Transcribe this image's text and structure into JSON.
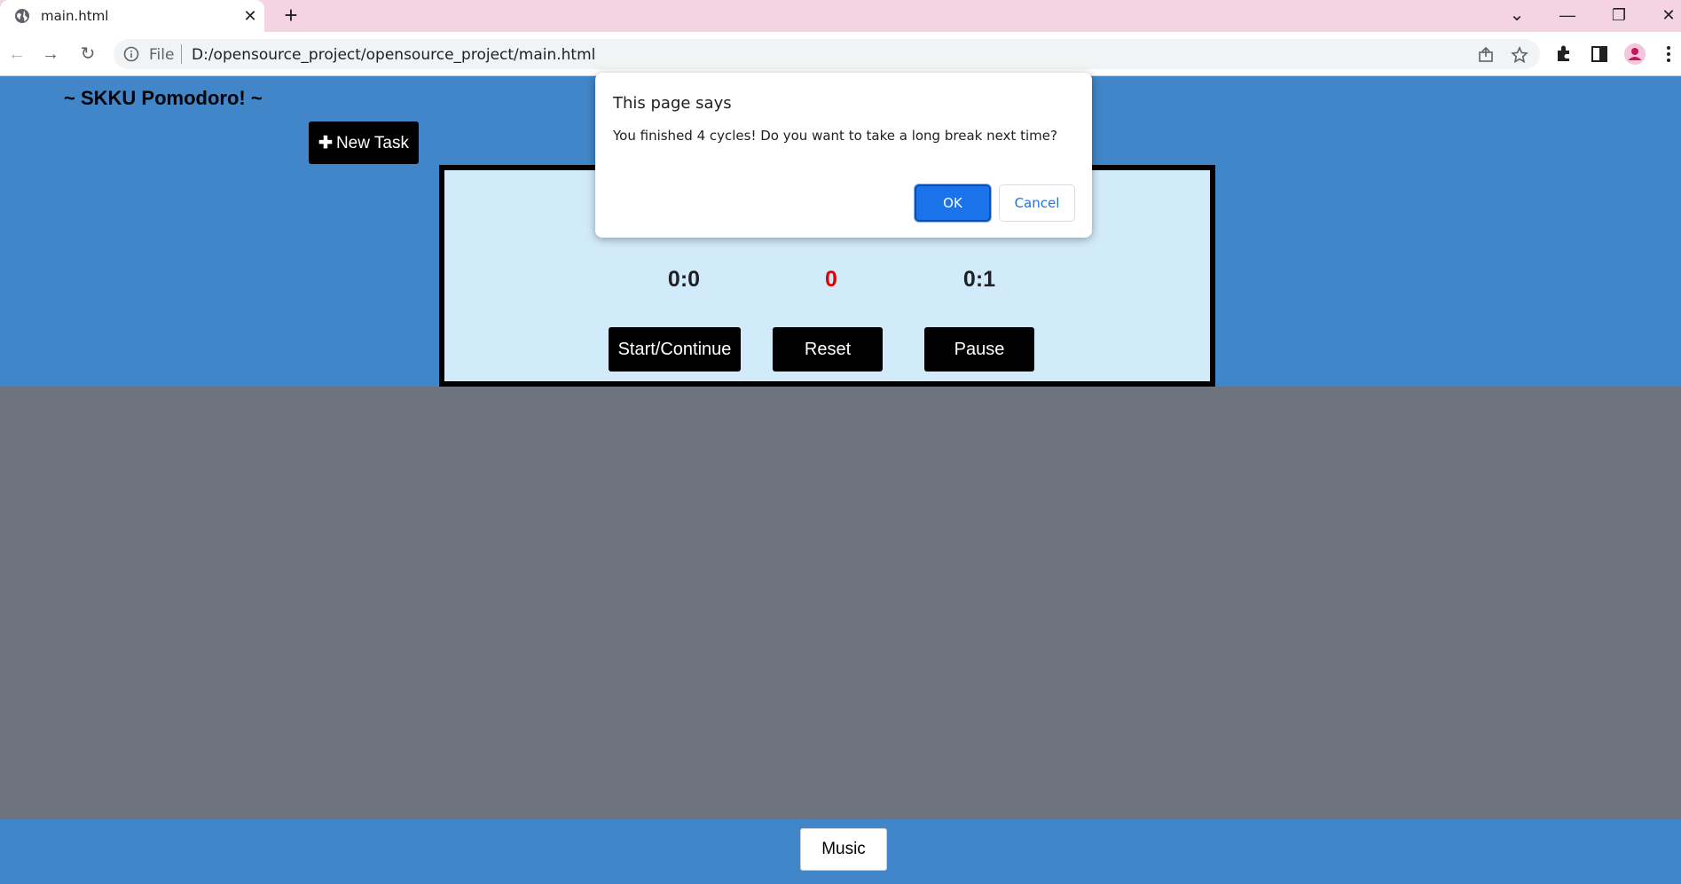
{
  "browser": {
    "tab": {
      "title": "main.html",
      "favicon": "globe-icon",
      "close_glyph": "✕"
    },
    "new_tab_glyph": "+",
    "window_controls": {
      "tab_search": "⌄",
      "minimize": "—",
      "restore": "❐",
      "close": "✕"
    },
    "nav": {
      "back": "←",
      "forward": "→",
      "reload": "↻"
    },
    "omnibox": {
      "scheme_label": "File",
      "url": "D:/opensource_project/opensource_project/main.html"
    },
    "icons": [
      "share-icon",
      "star-icon",
      "extensions-icon",
      "side-panel-icon",
      "profile-icon",
      "menu-icon"
    ]
  },
  "app": {
    "title": "~ SKKU Pomodoro! ~",
    "new_task_plus": "✚",
    "new_task_label": "New Task",
    "timer": {
      "left_time": "0:0",
      "cycle_count": "0",
      "right_time": "0:1",
      "start_label": "Start/Continue",
      "reset_label": "Reset",
      "pause_label": "Pause"
    },
    "music_label": "Music"
  },
  "dialog": {
    "title": "This page says",
    "message": "You finished 4 cycles! Do you want to take a long break next time?",
    "ok_label": "OK",
    "cancel_label": "Cancel"
  },
  "colors": {
    "page_blue": "#4186c8",
    "panel_bg": "#d2ebfb",
    "page_gray": "#6e747d",
    "tabstrip_pink": "#f4d3e3",
    "accent_blue": "#1a73e8",
    "cycle_red": "#e00000"
  }
}
